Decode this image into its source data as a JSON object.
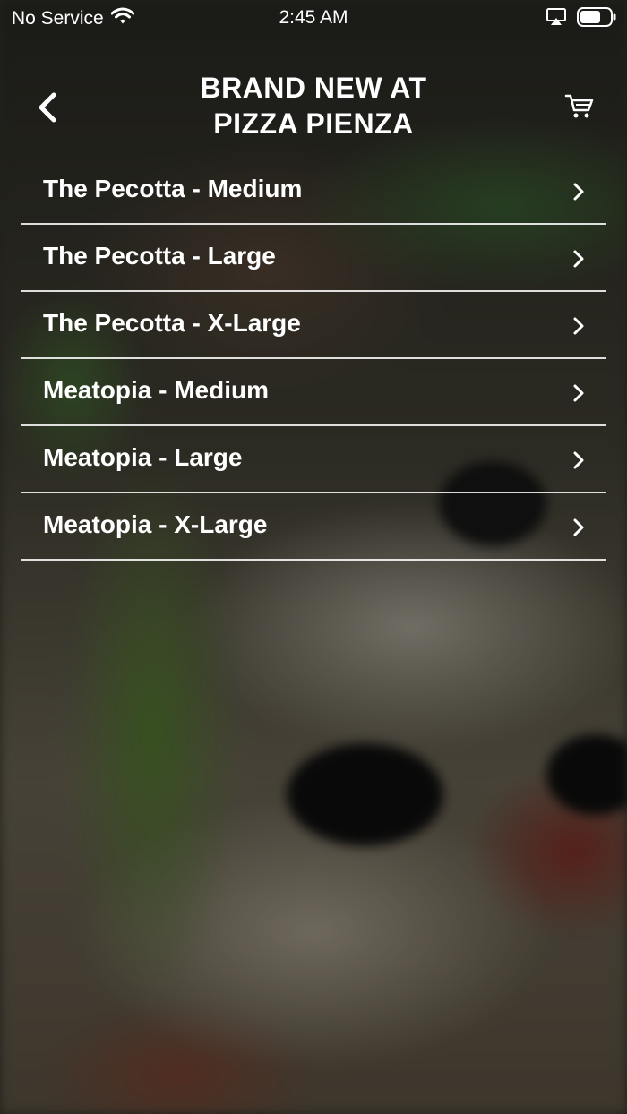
{
  "status_bar": {
    "carrier": "No Service",
    "time": "2:45 AM"
  },
  "header": {
    "title_line1": "BRAND NEW AT",
    "title_line2": "PIZZA PIENZA"
  },
  "menu": {
    "items": [
      {
        "label": "The Pecotta - Medium"
      },
      {
        "label": "The Pecotta - Large"
      },
      {
        "label": "The Pecotta - X-Large"
      },
      {
        "label": "Meatopia - Medium"
      },
      {
        "label": "Meatopia - Large"
      },
      {
        "label": "Meatopia - X-Large"
      }
    ]
  },
  "icons": {
    "back": "chevron-left-icon",
    "cart": "cart-icon",
    "row_chevron": "chevron-right-icon",
    "wifi": "wifi-icon",
    "airplay": "airplay-icon",
    "battery": "battery-icon"
  },
  "colors": {
    "text": "#ffffff",
    "divider": "#ffffff"
  }
}
